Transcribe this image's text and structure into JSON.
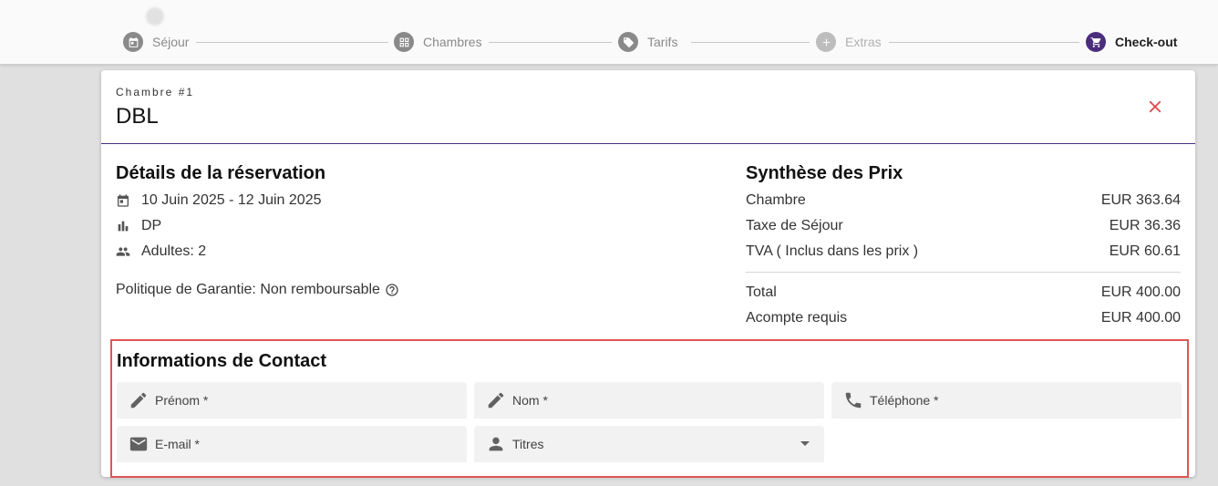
{
  "stepper": {
    "steps": [
      {
        "label": "Séjour",
        "icon": "calendar-icon"
      },
      {
        "label": "Chambres",
        "icon": "grid-icon"
      },
      {
        "label": "Tarifs",
        "icon": "tag-icon"
      },
      {
        "label": "Extras",
        "icon": "plus-icon"
      },
      {
        "label": "Check-out",
        "icon": "cart-icon"
      }
    ],
    "active": "Check-out"
  },
  "room": {
    "overline": "Chambre #1",
    "title": "DBL"
  },
  "details": {
    "title": "Détails de la réservation",
    "dates": "10 Juin 2025 - 12 Juin 2025",
    "board": "DP",
    "guests": "Adultes: 2",
    "policy": "Politique de Garantie: Non remboursable"
  },
  "prices": {
    "title": "Synthèse des Prix",
    "rows": [
      {
        "label": "Chambre",
        "value": "EUR 363.64"
      },
      {
        "label": "Taxe de Séjour",
        "value": "EUR 36.36"
      },
      {
        "label": "TVA ( Inclus dans les prix )",
        "value": "EUR 60.61"
      }
    ],
    "total": {
      "label": "Total",
      "value": "EUR 400.00"
    },
    "deposit": {
      "label": "Acompte requis",
      "value": "EUR 400.00"
    }
  },
  "contact": {
    "title": "Informations de Contact",
    "first_name": "Prénom *",
    "last_name": "Nom *",
    "phone": "Téléphone *",
    "email": "E-mail *",
    "titles": "Titres"
  },
  "colors": {
    "accent": "#4a2e7d",
    "close": "#e04848",
    "highlight_border": "#e05555"
  }
}
